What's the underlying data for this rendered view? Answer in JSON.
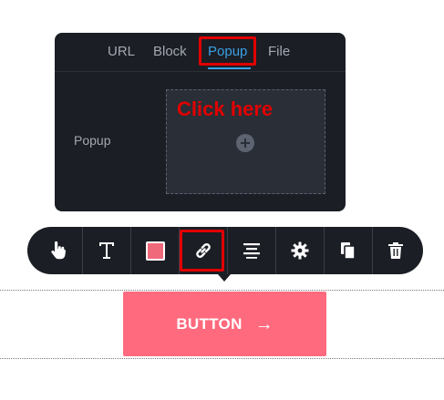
{
  "popover": {
    "tabs": [
      "URL",
      "Block",
      "Popup",
      "File"
    ],
    "active_tab": "Popup",
    "field_label": "Popup",
    "annotation": "Click here"
  },
  "toolbar": {
    "tools": [
      "interaction-icon",
      "text-icon",
      "color-swatch",
      "link-icon",
      "align-center-icon",
      "settings-icon",
      "duplicate-icon",
      "delete-icon"
    ],
    "color_swatch": "#f0697a",
    "highlighted_tool": "link-icon"
  },
  "canvas": {
    "button_label": "BUTTON",
    "button_color": "#ff6a7e",
    "highlight_color": "#e10000",
    "accent_color": "#3aa0e6"
  }
}
